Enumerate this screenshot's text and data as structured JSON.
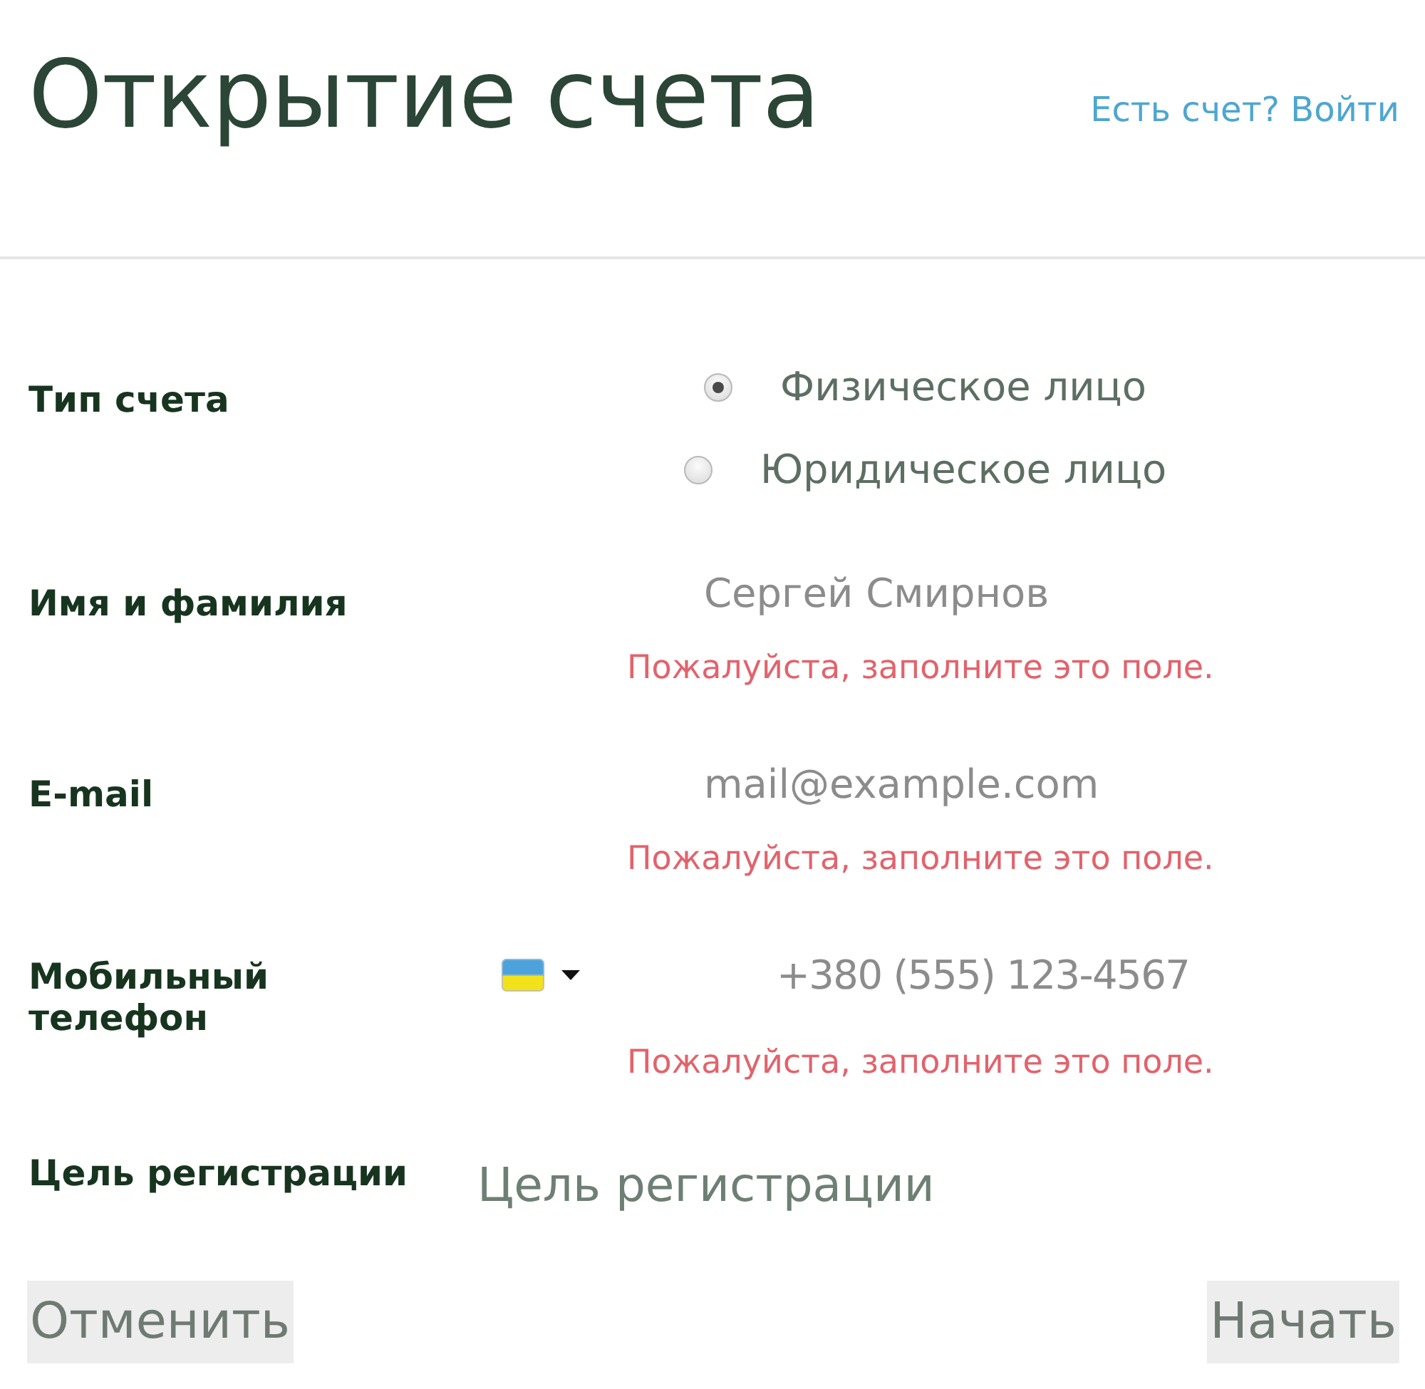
{
  "header": {
    "title": "Открытие счета",
    "login_link": "Есть счет? Войти"
  },
  "form": {
    "rows": [
      {
        "kind": "radio",
        "label": "Тип счета",
        "options": [
          {
            "label": "Физическое лицо",
            "selected": true
          },
          {
            "label": "Юридическое лицо",
            "selected": false
          }
        ]
      },
      {
        "kind": "text",
        "label": "Имя и фамилия",
        "placeholder": "Сергей Смирнов",
        "error": "Пожалуйста, заполните это поле."
      },
      {
        "kind": "text",
        "label": "E-mail",
        "placeholder": "mail@example.com",
        "error": "Пожалуйста, заполните это поле."
      },
      {
        "kind": "phone",
        "label": "Мобильный телефон",
        "placeholder": "+380 (555) 123-4567",
        "error": "Пожалуйста, заполните это поле."
      },
      {
        "kind": "wide",
        "label": "Цель регистрации",
        "placeholder": "Цель регистрации"
      }
    ]
  },
  "buttons": [
    "Отменить",
    "Начать"
  ]
}
